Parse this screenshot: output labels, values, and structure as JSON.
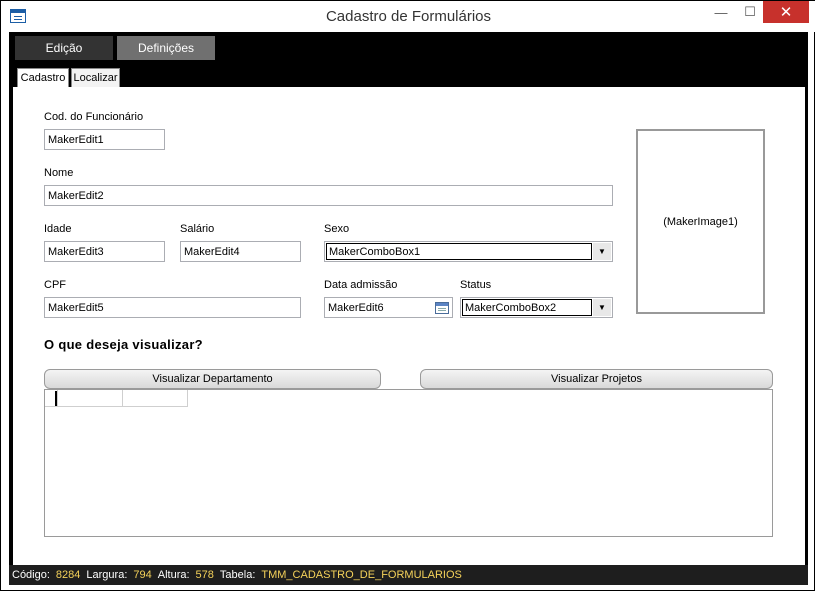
{
  "window": {
    "title": "Cadastro de Formulários",
    "icon": "form-window-icon",
    "controls": {
      "minimize": "—",
      "maximize": "☐",
      "close": "✕"
    }
  },
  "main_tabs": [
    "Edição",
    "Definições"
  ],
  "sub_tabs": [
    "Cadastro",
    "Localizar"
  ],
  "form": {
    "cod_label": "Cod. do Funcionário",
    "cod_value": "MakerEdit1",
    "nome_label": "Nome",
    "nome_value": "MakerEdit2",
    "idade_label": "Idade",
    "idade_value": "MakerEdit3",
    "salario_label": "Salário",
    "salario_value": "MakerEdit4",
    "sexo_label": "Sexo",
    "sexo_value": "MakerComboBox1",
    "cpf_label": "CPF",
    "cpf_value": "MakerEdit5",
    "admissao_label": "Data admissão",
    "admissao_value": "MakerEdit6",
    "status_label": "Status",
    "status_value": "MakerComboBox2",
    "image_text": "(MakerImage1)"
  },
  "view": {
    "question": "O que deseja visualizar?",
    "btn_departamento": "Visualizar Departamento",
    "btn_projetos": "Visualizar Projetos"
  },
  "status_bar": {
    "codigo_label": "Código:",
    "codigo_value": "8284",
    "largura_label": "Largura:",
    "largura_value": "794",
    "altura_label": "Altura:",
    "altura_value": "578",
    "tabela_label": "Tabela:",
    "tabela_value": "TMM_CADASTRO_DE_FORMULARIOS"
  },
  "colors": {
    "chrome": "#000000",
    "tab_active": "#333333",
    "tab_inactive": "#707070",
    "status_value": "#f5d25a",
    "close_button": "#c7312c"
  }
}
